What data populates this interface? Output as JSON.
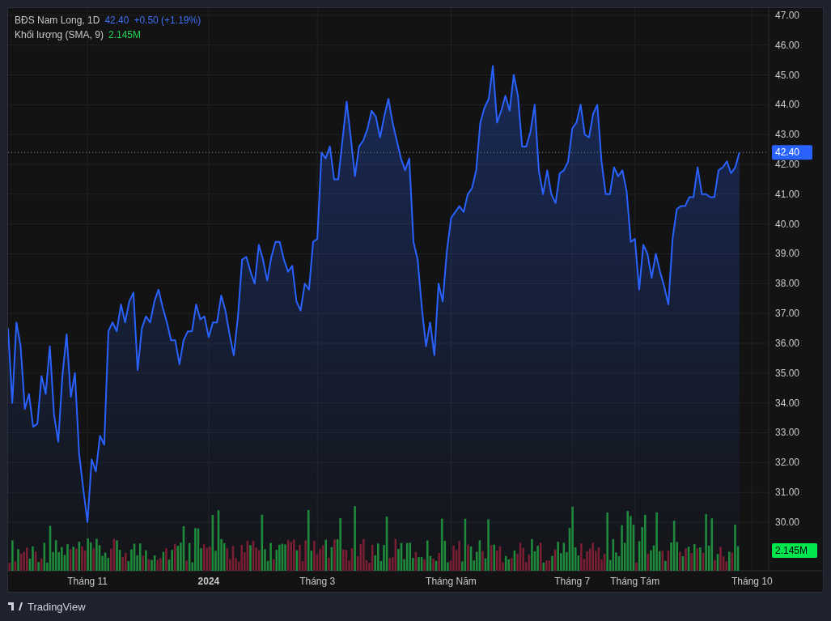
{
  "legend": {
    "interval": ", 1D",
    "price": "42.40",
    "change": "+0.50 (+1.19%)",
    "volume_label": "Khối lượng (SMA, 9)",
    "volume_value": "2.145M"
  },
  "price_badge": "42.40",
  "volume_badge": "2.145M",
  "chart_data": {
    "type": "area",
    "grid": true,
    "ref_lines": [
      {
        "axis": "y",
        "value": 42.4
      }
    ],
    "ylim": [
      28.37,
      47.24
    ],
    "categories": [
      null,
      null,
      null,
      null,
      null,
      null,
      null,
      null,
      null,
      null,
      null,
      null,
      null,
      null,
      null,
      null,
      null,
      null,
      null,
      "Tháng 11",
      null,
      null,
      null,
      null,
      null,
      null,
      null,
      null,
      null,
      null,
      null,
      null,
      null,
      null,
      null,
      null,
      null,
      null,
      null,
      null,
      null,
      null,
      null,
      null,
      null,
      null,
      null,
      null,
      "2024",
      null,
      null,
      null,
      null,
      null,
      null,
      null,
      null,
      null,
      null,
      null,
      null,
      null,
      null,
      null,
      null,
      null,
      null,
      null,
      null,
      null,
      null,
      null,
      null,
      null,
      "Tháng 3",
      null,
      null,
      null,
      null,
      null,
      null,
      null,
      null,
      null,
      null,
      null,
      null,
      null,
      null,
      null,
      null,
      null,
      null,
      null,
      null,
      null,
      null,
      null,
      null,
      null,
      null,
      null,
      null,
      null,
      null,
      null,
      "Tháng Năm",
      null,
      null,
      null,
      null,
      null,
      null,
      null,
      null,
      null,
      null,
      null,
      null,
      null,
      null,
      null,
      null,
      null,
      null,
      null,
      null,
      null,
      null,
      null,
      null,
      null,
      null,
      null,
      null,
      "Tháng 7",
      null,
      null,
      null,
      null,
      null,
      null,
      null,
      null,
      null,
      null,
      null,
      null,
      null,
      null,
      "Tháng Tám",
      null,
      null,
      null,
      null,
      null,
      null,
      null,
      null,
      null,
      null,
      null,
      null,
      null,
      null,
      null,
      null,
      null,
      null,
      null,
      null,
      null,
      null,
      null,
      null,
      null,
      null,
      null,
      "Tháng 10"
    ],
    "series": [
      {
        "name": "BĐS Nam Long",
        "color": "#2962ff",
        "values": [
          36.5,
          34.0,
          36.7,
          35.9,
          33.8,
          34.3,
          33.2,
          33.3,
          34.9,
          34.3,
          35.9,
          33.6,
          32.7,
          34.9,
          36.3,
          34.2,
          35.0,
          32.3,
          31.1,
          30.0,
          32.1,
          31.7,
          32.9,
          32.6,
          36.4,
          36.7,
          36.4,
          37.3,
          36.7,
          37.4,
          37.7,
          35.1,
          36.5,
          36.9,
          36.7,
          37.4,
          37.8,
          37.2,
          36.7,
          36.1,
          36.1,
          35.3,
          36.1,
          36.4,
          36.4,
          37.3,
          36.8,
          36.9,
          36.2,
          36.7,
          36.7,
          37.6,
          37.1,
          36.3,
          35.6,
          36.9,
          38.8,
          38.9,
          38.4,
          38.0,
          39.3,
          38.8,
          38.1,
          38.9,
          39.4,
          39.4,
          38.8,
          38.4,
          38.6,
          37.4,
          37.1,
          38.0,
          37.8,
          39.4,
          39.5,
          42.4,
          42.2,
          42.6,
          41.5,
          41.5,
          42.8,
          44.1,
          42.9,
          41.6,
          42.6,
          42.8,
          43.2,
          43.8,
          43.6,
          42.9,
          43.6,
          44.2,
          43.4,
          42.8,
          42.2,
          41.8,
          42.2,
          39.4,
          38.8,
          37.2,
          35.9,
          36.7,
          35.6,
          38.0,
          37.4,
          39.1,
          40.2,
          40.4,
          40.6,
          40.4,
          41.0,
          41.2,
          41.8,
          43.4,
          43.9,
          44.2,
          45.3,
          43.4,
          43.8,
          44.3,
          43.8,
          45.0,
          44.3,
          42.6,
          42.6,
          43.1,
          44.0,
          41.8,
          41.0,
          41.8,
          41.0,
          40.7,
          41.7,
          41.8,
          42.1,
          43.2,
          43.4,
          44.0,
          43.0,
          42.9,
          43.7,
          44.0,
          42.1,
          41.0,
          41.0,
          41.9,
          41.6,
          41.8,
          41.1,
          39.4,
          39.5,
          37.8,
          39.3,
          39.0,
          38.2,
          39.0,
          38.4,
          37.9,
          37.3,
          39.5,
          40.5,
          40.6,
          40.6,
          40.9,
          40.9,
          41.9,
          41.0,
          41.0,
          40.9,
          40.9,
          41.8,
          41.9,
          42.1,
          41.7,
          41.9,
          42.4,
          null,
          null,
          null
        ]
      }
    ],
    "yticks": [
      {
        "value": 30,
        "label": "30.00"
      },
      {
        "value": 31,
        "label": "31.00"
      },
      {
        "value": 32,
        "label": "32.00"
      },
      {
        "value": 33,
        "label": "33.00"
      },
      {
        "value": 34,
        "label": "34.00"
      },
      {
        "value": 35,
        "label": "35.00"
      },
      {
        "value": 36,
        "label": "36.00"
      },
      {
        "value": 37,
        "label": "37.00"
      },
      {
        "value": 38,
        "label": "38.00"
      },
      {
        "value": 39,
        "label": "39.00"
      },
      {
        "value": 40,
        "label": "40.00"
      },
      {
        "value": 41,
        "label": "41.00"
      },
      {
        "value": 42,
        "label": "42.00"
      },
      {
        "value": 43,
        "label": "43.00"
      },
      {
        "value": 44,
        "label": "44.00"
      },
      {
        "value": 45,
        "label": "45.00"
      },
      {
        "value": 46,
        "label": "46.00"
      },
      {
        "value": 47,
        "label": "47.00"
      }
    ]
  },
  "footer": {
    "brand": "TradingView"
  }
}
